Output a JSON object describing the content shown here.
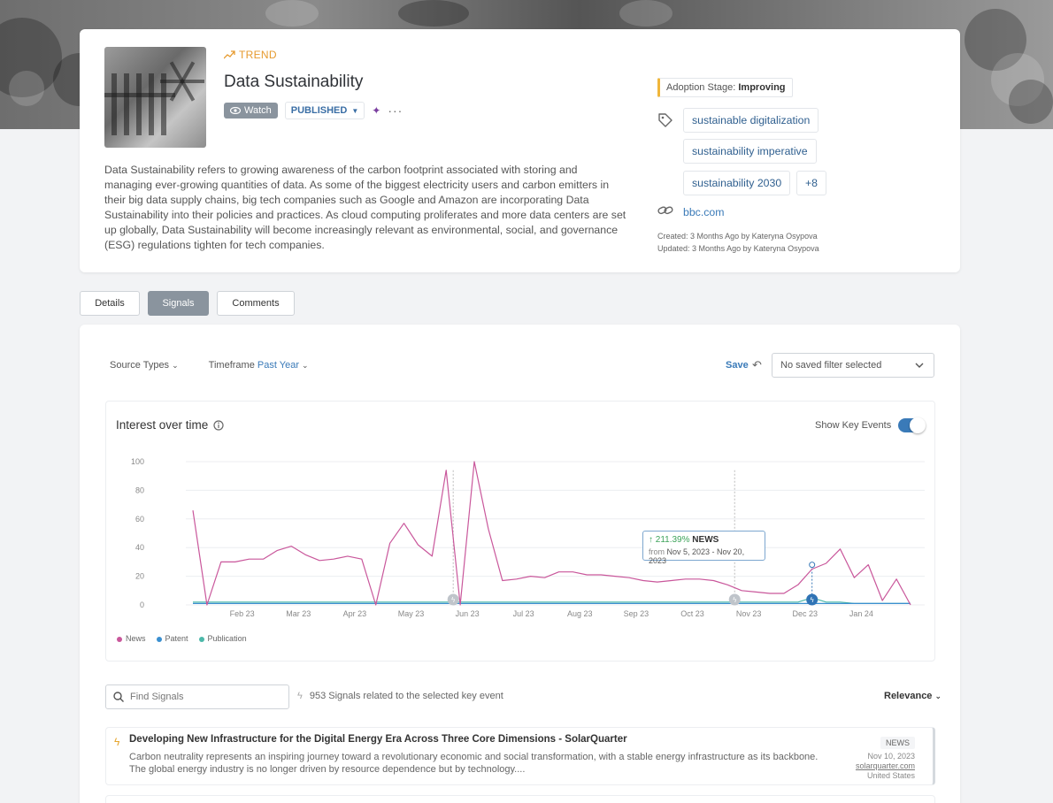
{
  "trend": {
    "label": "TREND",
    "title": "Data Sustainability",
    "watch_label": "Watch",
    "status_label": "PUBLISHED",
    "description": "Data Sustainability refers to growing awareness of the carbon footprint associated with storing and managing ever-growing quantities of data. As some of the biggest electricity users and carbon emitters in their big data supply chains, big tech companies such as Google and Amazon are incorporating Data Sustainability into their policies and practices. As cloud computing proliferates and more data centers are set up globally, Data Sustainability will become increasingly relevant as environmental, social, and governance (ESG) regulations tighten for tech companies."
  },
  "sidebar": {
    "adoption_prefix": "Adoption Stage:",
    "adoption_value": "Improving",
    "tags": [
      "sustainable digitalization",
      "sustainability imperative",
      "sustainability 2030"
    ],
    "more_tags": "+8",
    "link": "bbc.com",
    "created": {
      "label": "Created:",
      "value": "3 Months Ago",
      "by": "by",
      "author": "Kateryna Osypova"
    },
    "updated": {
      "label": "Updated:",
      "value": "3 Months Ago",
      "by": "by",
      "author": "Kateryna Osypova"
    }
  },
  "tabs": [
    {
      "label": "Details",
      "active": false
    },
    {
      "label": "Signals",
      "active": true
    },
    {
      "label": "Comments",
      "active": false
    }
  ],
  "filters": {
    "source_types": "Source Types",
    "timeframe_label": "Timeframe",
    "timeframe_value": "Past Year",
    "save": "Save",
    "saved_filter": "No saved filter selected"
  },
  "chart_header": {
    "title": "Interest over time",
    "show_key_events": "Show Key Events",
    "key_events_on": true
  },
  "tooltip": {
    "pct": "↑ 211.39%",
    "source": "NEWS",
    "from_label": "from",
    "range": "Nov 5, 2023 - Nov 20, 2023"
  },
  "chart_data": {
    "type": "line",
    "ylim": [
      0,
      100
    ],
    "yticks": [
      0,
      20,
      40,
      60,
      80,
      100
    ],
    "x_ticks": [
      {
        "label": "Feb 23",
        "x": 3.5
      },
      {
        "label": "Mar 23",
        "x": 7.5
      },
      {
        "label": "Apr 23",
        "x": 11.5
      },
      {
        "label": "May 23",
        "x": 15.5
      },
      {
        "label": "Jun 23",
        "x": 19.5
      },
      {
        "label": "Jul 23",
        "x": 23.5
      },
      {
        "label": "Aug 23",
        "x": 27.5
      },
      {
        "label": "Sep 23",
        "x": 31.5
      },
      {
        "label": "Oct 23",
        "x": 35.5
      },
      {
        "label": "Nov 23",
        "x": 39.5
      },
      {
        "label": "Dec 23",
        "x": 43.5
      },
      {
        "label": "Jan 24",
        "x": 47.5
      }
    ],
    "series": [
      {
        "name": "News",
        "color": "#c9579b",
        "values": [
          66,
          0,
          30,
          30,
          32,
          32,
          38,
          41,
          35,
          31,
          32,
          34,
          32,
          0,
          43,
          57,
          42,
          34,
          94,
          0,
          100,
          53,
          17,
          18,
          20,
          19,
          23,
          23,
          21,
          21,
          20,
          19,
          17,
          16,
          17,
          18,
          18,
          17,
          14,
          10,
          9,
          8,
          8,
          14,
          25,
          29,
          39,
          19,
          28,
          3,
          18,
          0
        ]
      },
      {
        "name": "Patent",
        "color": "#3a8fd0",
        "values": [
          1,
          1,
          1,
          1,
          1,
          1,
          1,
          1,
          1,
          1,
          1,
          1,
          1,
          1,
          1,
          1,
          1,
          1,
          1,
          1,
          1,
          1,
          1,
          1,
          1,
          1,
          1,
          1,
          1,
          1,
          1,
          1,
          1,
          1,
          1,
          1,
          1,
          1,
          1,
          1,
          1,
          1,
          1,
          1,
          1,
          1,
          1,
          1,
          1,
          1,
          1,
          1
        ]
      },
      {
        "name": "Publication",
        "color": "#4cb8a9",
        "values": [
          2,
          2,
          2,
          2,
          2,
          2,
          2,
          2,
          2,
          2,
          2,
          2,
          2,
          2,
          2,
          2,
          2,
          2,
          2,
          2,
          2,
          2,
          2,
          2,
          2,
          2,
          2,
          2,
          2,
          2,
          2,
          2,
          2,
          2,
          2,
          2,
          2,
          2,
          2,
          2,
          2,
          2,
          2,
          2,
          5,
          2,
          2,
          1,
          1,
          1,
          1,
          1
        ]
      }
    ],
    "key_events": [
      {
        "x": 18.5,
        "active": false
      },
      {
        "x": 38.5,
        "active": false
      },
      {
        "x": 44,
        "active": true
      }
    ]
  },
  "signals": {
    "search_placeholder": "Find Signals",
    "count_text": "953 Signals related to the selected key event",
    "sort_label": "Relevance",
    "items": [
      {
        "title": "Developing New Infrastructure for the Digital Energy Era Across Three Core Dimensions - SolarQuarter",
        "body": "Carbon neutrality represents an inspiring journey toward a revolutionary economic and social transformation, with a stable energy infrastructure as its backbone. The global energy industry is no longer driven by resource dependence but by technology....",
        "type": "NEWS",
        "date": "Nov 10, 2023",
        "source": "solarquarter.com",
        "country": "United States"
      }
    ]
  }
}
